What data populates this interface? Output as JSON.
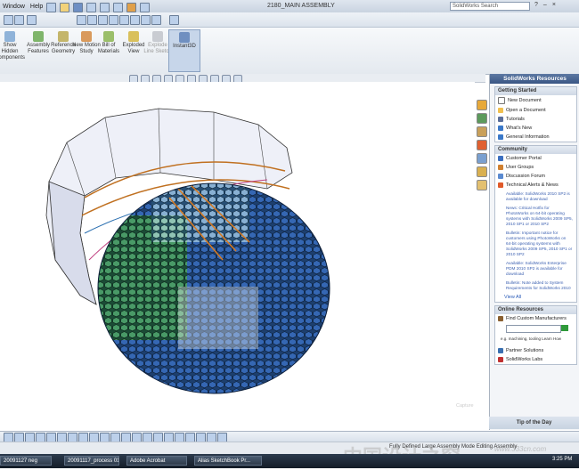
{
  "menu": {
    "window": "Window",
    "help": "Help"
  },
  "document_title": "2180_MAIN ASSEMBLY",
  "search": {
    "placeholder": "SolidWorks Search"
  },
  "command_manager": [
    {
      "label": "Show Hidden Components"
    },
    {
      "label": "Assembly Features"
    },
    {
      "label": "Reference Geometry"
    },
    {
      "label": "New Motion Study"
    },
    {
      "label": "Bill of Materials"
    },
    {
      "label": "Exploded View"
    },
    {
      "label": "Explode Line Sketch"
    },
    {
      "label": "Instant3D"
    }
  ],
  "panel": {
    "title": "SolidWorks Resources",
    "getting_started": {
      "title": "Getting Started",
      "items": [
        "New Document",
        "Open a Document",
        "Tutorials",
        "What's New",
        "General Information"
      ]
    },
    "community": {
      "title": "Community",
      "items": [
        "Customer Portal",
        "User Groups",
        "Discussion Forum",
        "Technical Alerts & News"
      ],
      "news": [
        "Available: SolidWorks 2010 SP2 is available for download",
        "News: Critical Hotfix for PhotoWorks on 64-bit operating systems with SolidWorks 2009 SP5, 2010 SP1 or 2010 SP2",
        "Bulletin: Important notice for customers using PhotoWorks on 64-bit operating systems with SolidWorks 2009 SP5, 2010 SP1 or 2010 SP2",
        "Available: SolidWorks Enterprise PDM 2010 SP2 is available for download",
        "Bulletin: Note added to System Requirements for SolidWorks 2010"
      ],
      "view_all": "View All"
    },
    "online_resources": {
      "title": "Online Resources",
      "find_label": "Find Custom Manufacturers",
      "links": "e.g. machining, tooling  Learn How",
      "items": [
        "Partner Solutions",
        "SolidWorks Labs"
      ]
    },
    "tip": "Tip of the Day"
  },
  "status": {
    "text": "Fully Defined   Large Assembly Mode   Editing Assembly"
  },
  "taskbar": [
    {
      "label": "20091127 neg"
    },
    {
      "label": "20091117_process 01..."
    },
    {
      "label": "Adobe Acrobat"
    },
    {
      "label": "Alias SketchBook Pr..."
    }
  ],
  "clock": "3:25 PM",
  "watermark": "中国设计之窗",
  "watermark2": "www.333cn.com",
  "capture_label": "Capture"
}
